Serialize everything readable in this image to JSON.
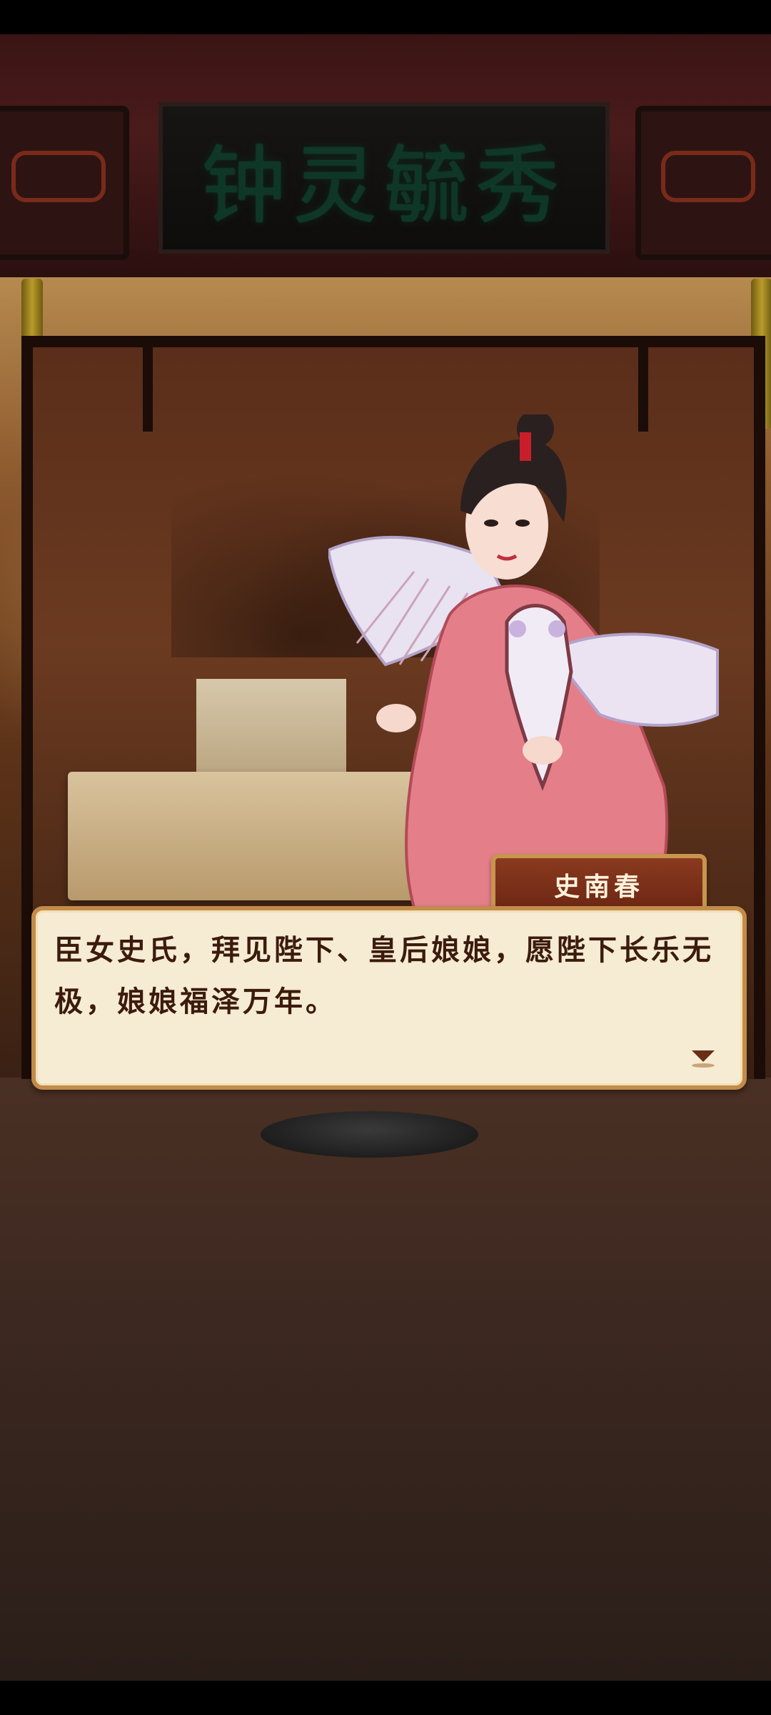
{
  "scene": {
    "plaque_title": "钟灵毓秀"
  },
  "dialog": {
    "speaker": "史南春",
    "text": "臣女史氏，拜见陛下、皇后娘娘，愿陛下长乐无极，娘娘福泽万年。"
  },
  "icons": {
    "next": "triangle-down-icon"
  },
  "colors": {
    "dialog_bg": "#f6ecd4",
    "dialog_border": "#c28b4a",
    "dialog_text": "#3c1b0d",
    "nameplate_bg": "#7a2e18"
  }
}
